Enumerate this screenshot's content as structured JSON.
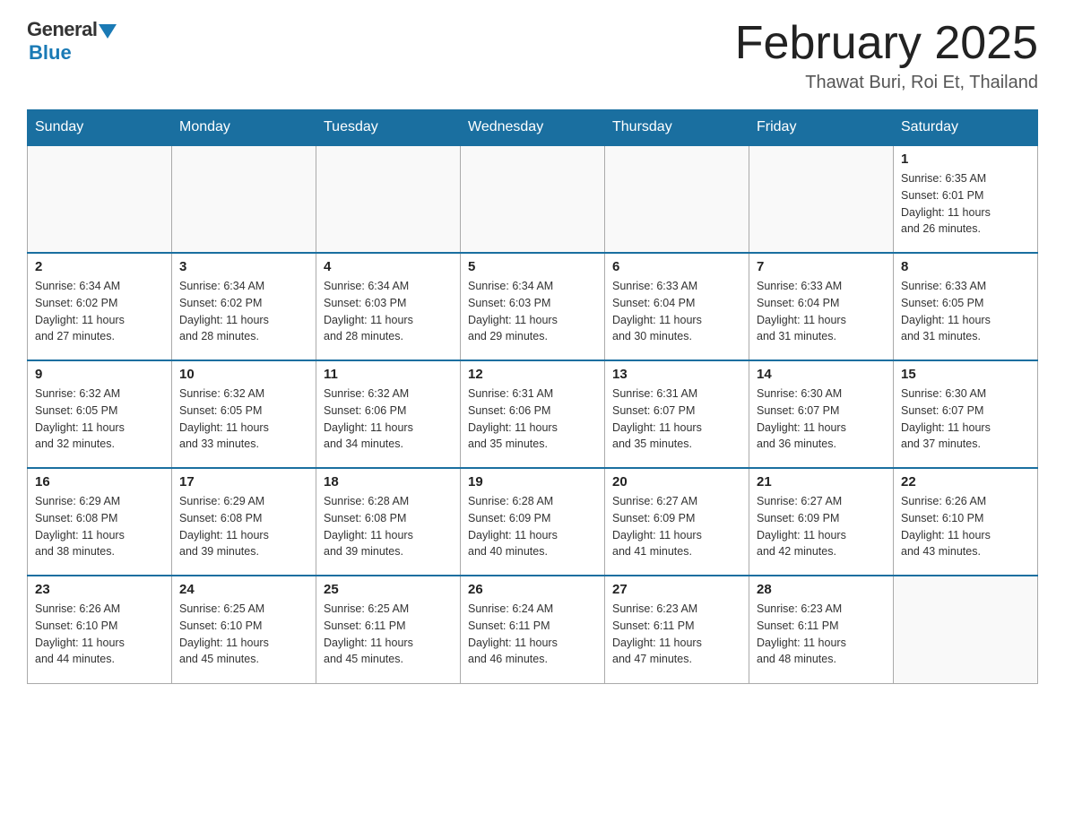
{
  "header": {
    "logo": {
      "general": "General",
      "blue": "Blue"
    },
    "title": "February 2025",
    "location": "Thawat Buri, Roi Et, Thailand"
  },
  "weekdays": [
    "Sunday",
    "Monday",
    "Tuesday",
    "Wednesday",
    "Thursday",
    "Friday",
    "Saturday"
  ],
  "weeks": [
    [
      {
        "day": "",
        "info": ""
      },
      {
        "day": "",
        "info": ""
      },
      {
        "day": "",
        "info": ""
      },
      {
        "day": "",
        "info": ""
      },
      {
        "day": "",
        "info": ""
      },
      {
        "day": "",
        "info": ""
      },
      {
        "day": "1",
        "info": "Sunrise: 6:35 AM\nSunset: 6:01 PM\nDaylight: 11 hours\nand 26 minutes."
      }
    ],
    [
      {
        "day": "2",
        "info": "Sunrise: 6:34 AM\nSunset: 6:02 PM\nDaylight: 11 hours\nand 27 minutes."
      },
      {
        "day": "3",
        "info": "Sunrise: 6:34 AM\nSunset: 6:02 PM\nDaylight: 11 hours\nand 28 minutes."
      },
      {
        "day": "4",
        "info": "Sunrise: 6:34 AM\nSunset: 6:03 PM\nDaylight: 11 hours\nand 28 minutes."
      },
      {
        "day": "5",
        "info": "Sunrise: 6:34 AM\nSunset: 6:03 PM\nDaylight: 11 hours\nand 29 minutes."
      },
      {
        "day": "6",
        "info": "Sunrise: 6:33 AM\nSunset: 6:04 PM\nDaylight: 11 hours\nand 30 minutes."
      },
      {
        "day": "7",
        "info": "Sunrise: 6:33 AM\nSunset: 6:04 PM\nDaylight: 11 hours\nand 31 minutes."
      },
      {
        "day": "8",
        "info": "Sunrise: 6:33 AM\nSunset: 6:05 PM\nDaylight: 11 hours\nand 31 minutes."
      }
    ],
    [
      {
        "day": "9",
        "info": "Sunrise: 6:32 AM\nSunset: 6:05 PM\nDaylight: 11 hours\nand 32 minutes."
      },
      {
        "day": "10",
        "info": "Sunrise: 6:32 AM\nSunset: 6:05 PM\nDaylight: 11 hours\nand 33 minutes."
      },
      {
        "day": "11",
        "info": "Sunrise: 6:32 AM\nSunset: 6:06 PM\nDaylight: 11 hours\nand 34 minutes."
      },
      {
        "day": "12",
        "info": "Sunrise: 6:31 AM\nSunset: 6:06 PM\nDaylight: 11 hours\nand 35 minutes."
      },
      {
        "day": "13",
        "info": "Sunrise: 6:31 AM\nSunset: 6:07 PM\nDaylight: 11 hours\nand 35 minutes."
      },
      {
        "day": "14",
        "info": "Sunrise: 6:30 AM\nSunset: 6:07 PM\nDaylight: 11 hours\nand 36 minutes."
      },
      {
        "day": "15",
        "info": "Sunrise: 6:30 AM\nSunset: 6:07 PM\nDaylight: 11 hours\nand 37 minutes."
      }
    ],
    [
      {
        "day": "16",
        "info": "Sunrise: 6:29 AM\nSunset: 6:08 PM\nDaylight: 11 hours\nand 38 minutes."
      },
      {
        "day": "17",
        "info": "Sunrise: 6:29 AM\nSunset: 6:08 PM\nDaylight: 11 hours\nand 39 minutes."
      },
      {
        "day": "18",
        "info": "Sunrise: 6:28 AM\nSunset: 6:08 PM\nDaylight: 11 hours\nand 39 minutes."
      },
      {
        "day": "19",
        "info": "Sunrise: 6:28 AM\nSunset: 6:09 PM\nDaylight: 11 hours\nand 40 minutes."
      },
      {
        "day": "20",
        "info": "Sunrise: 6:27 AM\nSunset: 6:09 PM\nDaylight: 11 hours\nand 41 minutes."
      },
      {
        "day": "21",
        "info": "Sunrise: 6:27 AM\nSunset: 6:09 PM\nDaylight: 11 hours\nand 42 minutes."
      },
      {
        "day": "22",
        "info": "Sunrise: 6:26 AM\nSunset: 6:10 PM\nDaylight: 11 hours\nand 43 minutes."
      }
    ],
    [
      {
        "day": "23",
        "info": "Sunrise: 6:26 AM\nSunset: 6:10 PM\nDaylight: 11 hours\nand 44 minutes."
      },
      {
        "day": "24",
        "info": "Sunrise: 6:25 AM\nSunset: 6:10 PM\nDaylight: 11 hours\nand 45 minutes."
      },
      {
        "day": "25",
        "info": "Sunrise: 6:25 AM\nSunset: 6:11 PM\nDaylight: 11 hours\nand 45 minutes."
      },
      {
        "day": "26",
        "info": "Sunrise: 6:24 AM\nSunset: 6:11 PM\nDaylight: 11 hours\nand 46 minutes."
      },
      {
        "day": "27",
        "info": "Sunrise: 6:23 AM\nSunset: 6:11 PM\nDaylight: 11 hours\nand 47 minutes."
      },
      {
        "day": "28",
        "info": "Sunrise: 6:23 AM\nSunset: 6:11 PM\nDaylight: 11 hours\nand 48 minutes."
      },
      {
        "day": "",
        "info": ""
      }
    ]
  ]
}
